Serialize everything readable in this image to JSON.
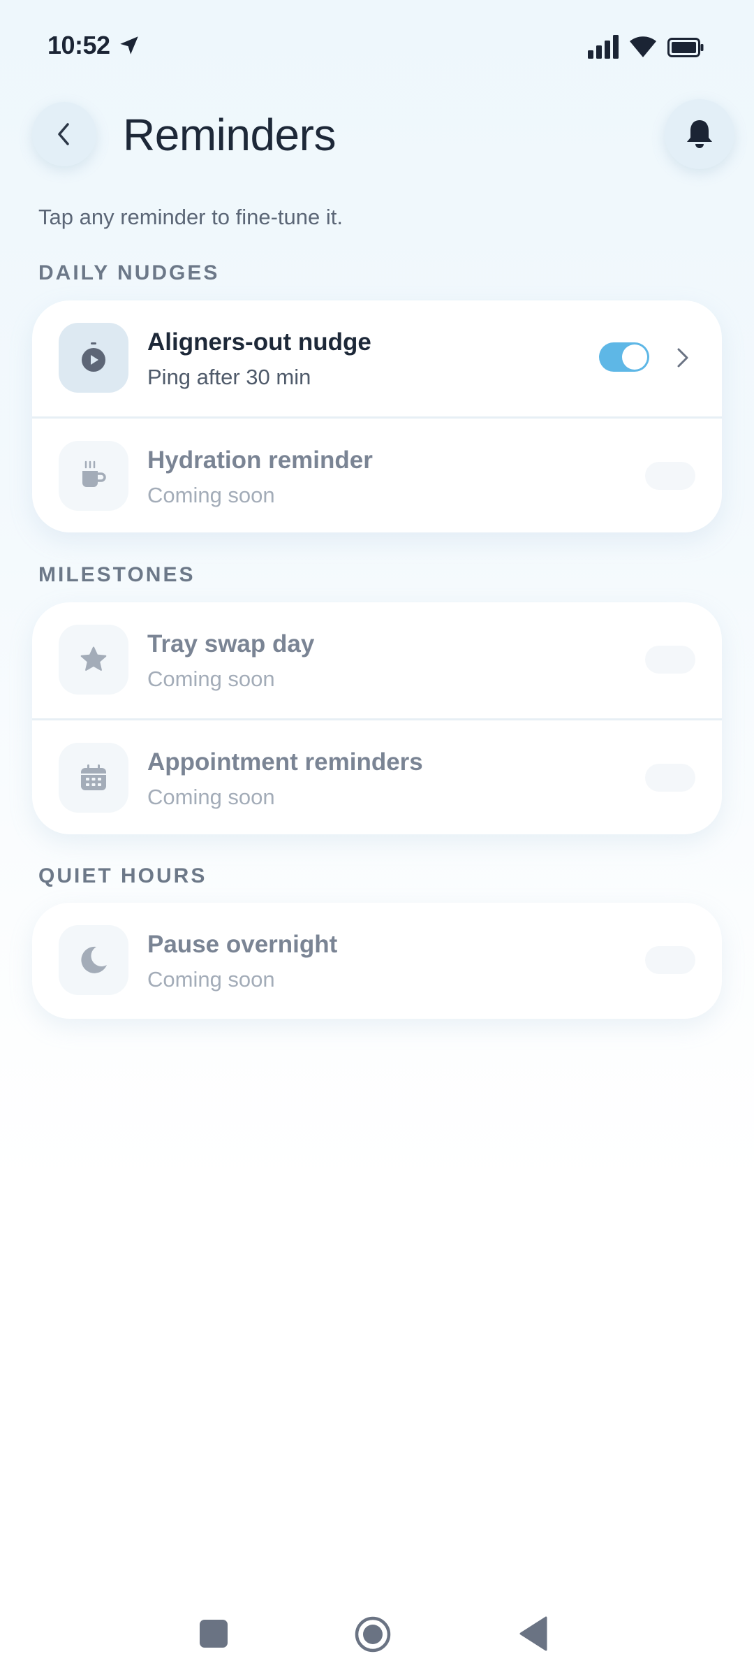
{
  "status_bar": {
    "time": "10:52",
    "icons": [
      "location-arrow-icon",
      "cellular-signal-icon",
      "wifi-icon",
      "battery-icon"
    ]
  },
  "header": {
    "title": "Reminders",
    "back_icon": "chevron-left-icon",
    "action_icon": "bell-icon"
  },
  "subtitle": "Tap any reminder to fine-tune it.",
  "sections": [
    {
      "label": "DAILY NUDGES",
      "items": [
        {
          "title": "Aligners-out nudge",
          "subtitle": "Ping after 30 min",
          "icon": "timer-icon",
          "enabled": true,
          "active": true
        },
        {
          "title": "Hydration reminder",
          "subtitle": "Coming soon",
          "icon": "cup-icon",
          "enabled": false,
          "active": false
        }
      ]
    },
    {
      "label": "MILESTONES",
      "items": [
        {
          "title": "Tray swap day",
          "subtitle": "Coming soon",
          "icon": "star-icon",
          "enabled": false,
          "active": false
        },
        {
          "title": "Appointment reminders",
          "subtitle": "Coming soon",
          "icon": "calendar-icon",
          "enabled": false,
          "active": false
        }
      ]
    },
    {
      "label": "QUIET HOURS",
      "items": [
        {
          "title": "Pause overnight",
          "subtitle": "Coming soon",
          "icon": "moon-icon",
          "enabled": false,
          "active": false
        }
      ]
    }
  ],
  "colors": {
    "accent": "#5eb7e6",
    "background": "#eef7fc",
    "card": "#ffffff",
    "text_primary": "#1d2838",
    "text_muted": "#7a8494"
  },
  "nav_bar": {
    "icons": [
      "recents-square-icon",
      "home-circle-icon",
      "back-triangle-icon"
    ]
  }
}
